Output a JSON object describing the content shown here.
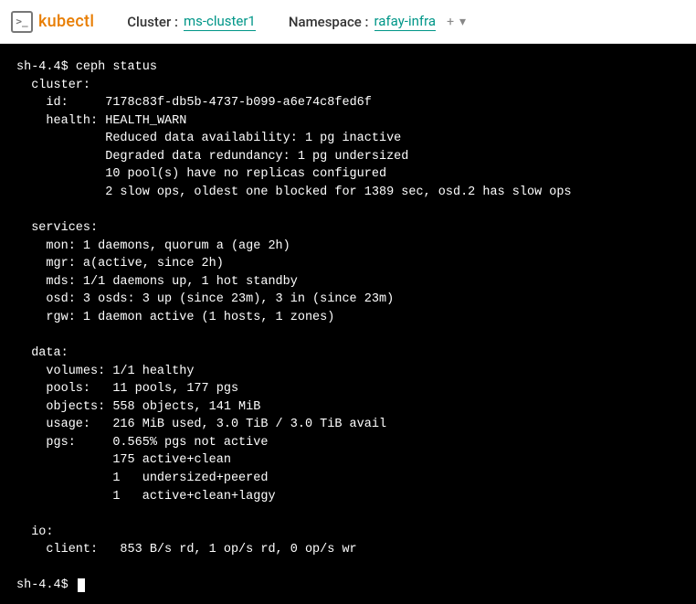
{
  "header": {
    "logo_symbol": ">_",
    "logo_text": "kubectl",
    "cluster_label": "Cluster :",
    "cluster_value": "ms-cluster1",
    "namespace_label": "Namespace :",
    "namespace_value": "rafay-infra",
    "add_symbol": "+",
    "dropdown_symbol": "▾"
  },
  "terminal": {
    "prompt": "sh-4.4$",
    "command": "ceph status",
    "cluster_header": "cluster:",
    "cluster": {
      "id_label": "id:",
      "id_value": "7178c83f-db5b-4737-b099-a6e74c8fed6f",
      "health_label": "health:",
      "health_value": "HEALTH_WARN",
      "warn1": "Reduced data availability: 1 pg inactive",
      "warn2": "Degraded data redundancy: 1 pg undersized",
      "warn3": "10 pool(s) have no replicas configured",
      "warn4": "2 slow ops, oldest one blocked for 1389 sec, osd.2 has slow ops"
    },
    "services_header": "services:",
    "services": {
      "mon": "mon: 1 daemons, quorum a (age 2h)",
      "mgr": "mgr: a(active, since 2h)",
      "mds": "mds: 1/1 daemons up, 1 hot standby",
      "osd": "osd: 3 osds: 3 up (since 23m), 3 in (since 23m)",
      "rgw": "rgw: 1 daemon active (1 hosts, 1 zones)"
    },
    "data_header": "data:",
    "data": {
      "volumes": "volumes: 1/1 healthy",
      "pools": "pools:   11 pools, 177 pgs",
      "objects": "objects: 558 objects, 141 MiB",
      "usage": "usage:   216 MiB used, 3.0 TiB / 3.0 TiB avail",
      "pgs": "pgs:     0.565% pgs not active",
      "pgs1": "175 active+clean",
      "pgs2": "1   undersized+peered",
      "pgs3": "1   active+clean+laggy"
    },
    "io_header": "io:",
    "io": {
      "client": "client:   853 B/s rd, 1 op/s rd, 0 op/s wr"
    }
  }
}
